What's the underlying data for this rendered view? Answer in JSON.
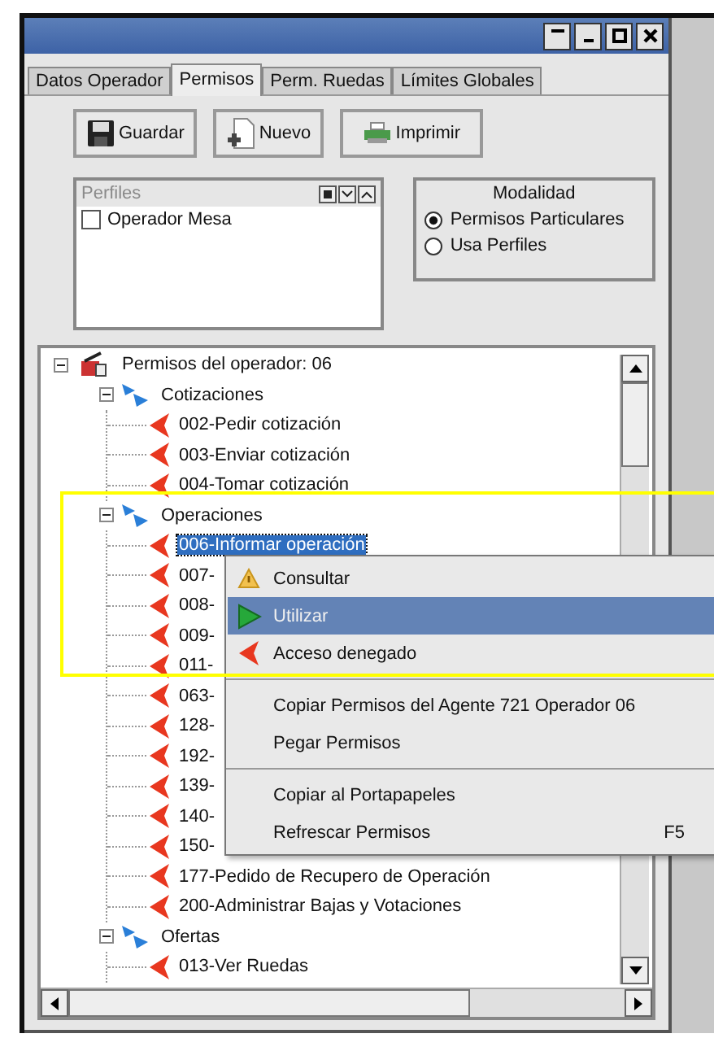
{
  "tabs": [
    {
      "label": "Datos Operador",
      "selected": false
    },
    {
      "label": "Permisos",
      "selected": true
    },
    {
      "label": "Perm. Ruedas",
      "selected": false
    },
    {
      "label": "Límites Globales",
      "selected": false
    }
  ],
  "toolbar": [
    {
      "label": "Guardar",
      "kind": "save"
    },
    {
      "label": "Nuevo",
      "kind": "new"
    },
    {
      "label": "Imprimir",
      "kind": "print"
    }
  ],
  "perfiles": {
    "title": "Perfiles",
    "items": [
      {
        "label": "Operador Mesa",
        "checked": false
      }
    ]
  },
  "modalidad": {
    "title": "Modalidad",
    "options": [
      {
        "label": "Permisos Particulares",
        "selected": true
      },
      {
        "label": "Usa Perfiles",
        "selected": false
      }
    ]
  },
  "tree": {
    "label": "Permisos del operador: 06",
    "expanded": true,
    "children": [
      {
        "label": "Cotizaciones",
        "expanded": true,
        "children": [
          {
            "label": "002-Pedir cotización",
            "selected": false
          },
          {
            "label": "003-Enviar cotización",
            "selected": false
          },
          {
            "label": "004-Tomar cotización",
            "selected": false
          }
        ]
      },
      {
        "label": "Operaciones",
        "expanded": true,
        "children": [
          {
            "label": "006-Informar operación",
            "selected": true
          },
          {
            "label": "007-",
            "selected": false
          },
          {
            "label": "008-",
            "selected": false
          },
          {
            "label": "009-",
            "selected": false
          },
          {
            "label": "011-",
            "selected": false
          },
          {
            "label": "063-",
            "selected": false
          },
          {
            "label": "128-",
            "selected": false
          },
          {
            "label": "192-",
            "selected": false
          },
          {
            "label": "139-",
            "selected": false
          },
          {
            "label": "140-",
            "selected": false
          },
          {
            "label": "150-",
            "selected": false
          },
          {
            "label": "177-Pedido de Recupero de Operación",
            "selected": false
          },
          {
            "label": "200-Administrar Bajas y Votaciones",
            "selected": false
          }
        ]
      },
      {
        "label": "Ofertas",
        "expanded": true,
        "children": [
          {
            "label": "013-Ver Ruedas",
            "selected": false
          }
        ]
      }
    ]
  },
  "context_menu": [
    {
      "kind": "consult",
      "label": "Consultar",
      "selected": false
    },
    {
      "kind": "use",
      "label": "Utilizar",
      "selected": true
    },
    {
      "kind": "deny",
      "label": "Acceso denegado",
      "selected": false
    },
    {
      "kind": "separator"
    },
    {
      "kind": "plain",
      "label": "Copiar Permisos del Agente 721 Operador 06",
      "selected": false
    },
    {
      "kind": "plain",
      "label": "Pegar Permisos",
      "selected": false
    },
    {
      "kind": "separator"
    },
    {
      "kind": "plain",
      "label": "Copiar al Portapapeles",
      "selected": false
    },
    {
      "kind": "plain",
      "label": "Refrescar Permisos",
      "shortcut": "F5",
      "selected": false
    }
  ]
}
